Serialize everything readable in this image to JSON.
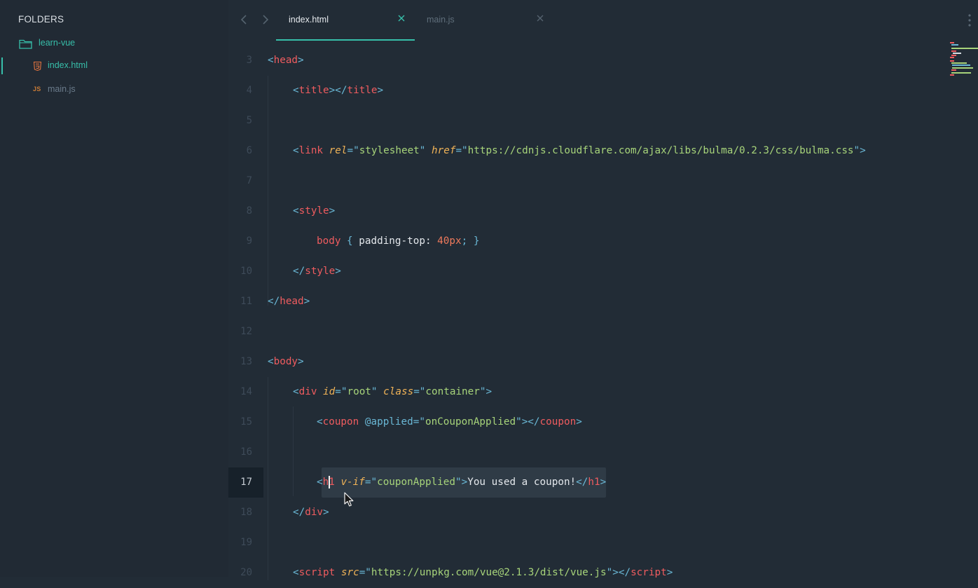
{
  "sidebar": {
    "header": "FOLDERS",
    "folder": {
      "name": "learn-vue",
      "icon": "folder-icon"
    },
    "files": [
      {
        "name": "index.html",
        "icon": "html5-icon",
        "active": true
      },
      {
        "name": "main.js",
        "icon": "js-icon",
        "icon_text": "JS",
        "active": false
      }
    ]
  },
  "tabs": [
    {
      "label": "index.html",
      "active": true
    },
    {
      "label": "main.js",
      "active": false
    }
  ],
  "editor": {
    "current_line": "17",
    "lines": [
      {
        "num": "3",
        "indent": 0,
        "tokens": [
          [
            "p",
            "<"
          ],
          [
            "t",
            "head"
          ],
          [
            "p",
            ">"
          ]
        ]
      },
      {
        "num": "4",
        "indent": 1,
        "tokens": [
          [
            "p",
            "<"
          ],
          [
            "t",
            "title"
          ],
          [
            "p",
            "></"
          ],
          [
            "t",
            "title"
          ],
          [
            "p",
            ">"
          ]
        ]
      },
      {
        "num": "5",
        "indent": 1,
        "tokens": []
      },
      {
        "num": "6",
        "indent": 1,
        "tokens": [
          [
            "p",
            "<"
          ],
          [
            "t",
            "link"
          ],
          [
            "w",
            " "
          ],
          [
            "a",
            "rel"
          ],
          [
            "p",
            "=\""
          ],
          [
            "s",
            "stylesheet"
          ],
          [
            "p",
            "\""
          ],
          [
            "w",
            " "
          ],
          [
            "a",
            "href"
          ],
          [
            "p",
            "=\""
          ],
          [
            "s",
            "https://cdnjs.cloudflare.com/ajax/libs/bulma/0.2.3/css/bulma.css"
          ],
          [
            "p",
            "\">"
          ]
        ]
      },
      {
        "num": "7",
        "indent": 1,
        "tokens": []
      },
      {
        "num": "8",
        "indent": 1,
        "tokens": [
          [
            "p",
            "<"
          ],
          [
            "t",
            "style"
          ],
          [
            "p",
            ">"
          ]
        ]
      },
      {
        "num": "9",
        "indent": 2,
        "tokens": [
          [
            "t",
            "body"
          ],
          [
            "w",
            " "
          ],
          [
            "p",
            "{"
          ],
          [
            "w",
            " padding-top: "
          ],
          [
            "n",
            "40px"
          ],
          [
            "p",
            ";"
          ],
          [
            "w",
            " "
          ],
          [
            "p",
            "}"
          ]
        ]
      },
      {
        "num": "10",
        "indent": 1,
        "tokens": [
          [
            "p",
            "</"
          ],
          [
            "t",
            "style"
          ],
          [
            "p",
            ">"
          ]
        ]
      },
      {
        "num": "11",
        "indent": 0,
        "tokens": [
          [
            "p",
            "</"
          ],
          [
            "t",
            "head"
          ],
          [
            "p",
            ">"
          ]
        ]
      },
      {
        "num": "12",
        "indent": 0,
        "tokens": []
      },
      {
        "num": "13",
        "indent": 0,
        "tokens": [
          [
            "p",
            "<"
          ],
          [
            "t",
            "body"
          ],
          [
            "p",
            ">"
          ]
        ]
      },
      {
        "num": "14",
        "indent": 1,
        "tokens": [
          [
            "p",
            "<"
          ],
          [
            "t",
            "div"
          ],
          [
            "w",
            " "
          ],
          [
            "a",
            "id"
          ],
          [
            "p",
            "=\""
          ],
          [
            "s",
            "root"
          ],
          [
            "p",
            "\""
          ],
          [
            "w",
            " "
          ],
          [
            "a",
            "class"
          ],
          [
            "p",
            "=\""
          ],
          [
            "s",
            "container"
          ],
          [
            "p",
            "\">"
          ]
        ]
      },
      {
        "num": "15",
        "indent": 2,
        "tokens": [
          [
            "p",
            "<"
          ],
          [
            "t",
            "coupon"
          ],
          [
            "w",
            " "
          ],
          [
            "p",
            "@applied"
          ],
          [
            "p",
            "=\""
          ],
          [
            "s",
            "onCouponApplied"
          ],
          [
            "p",
            "\"></"
          ],
          [
            "t",
            "coupon"
          ],
          [
            "p",
            ">"
          ]
        ]
      },
      {
        "num": "16",
        "indent": 2,
        "tokens": []
      },
      {
        "num": "17",
        "indent": 2,
        "tokens": [
          [
            "p",
            "<"
          ],
          [
            "t",
            "h1"
          ],
          [
            "w",
            " "
          ],
          [
            "a",
            "v-if"
          ],
          [
            "p",
            "=\""
          ],
          [
            "s",
            "couponApplied"
          ],
          [
            "p",
            "\">"
          ],
          [
            "w",
            "You used a coupon!"
          ],
          [
            "p",
            "</"
          ],
          [
            "t",
            "h1"
          ],
          [
            "p",
            ">"
          ]
        ]
      },
      {
        "num": "18",
        "indent": 1,
        "tokens": [
          [
            "p",
            "</"
          ],
          [
            "t",
            "div"
          ],
          [
            "p",
            ">"
          ]
        ]
      },
      {
        "num": "19",
        "indent": 1,
        "tokens": []
      },
      {
        "num": "20",
        "indent": 1,
        "tokens": [
          [
            "p",
            "<"
          ],
          [
            "t",
            "script"
          ],
          [
            "w",
            " "
          ],
          [
            "a",
            "src"
          ],
          [
            "p",
            "=\""
          ],
          [
            "s",
            "https://unpkg.com/vue@2.1.3/dist/vue.js"
          ],
          [
            "p",
            "\"></"
          ],
          [
            "t",
            "script"
          ],
          [
            "p",
            ">"
          ]
        ]
      }
    ]
  },
  "colors": {
    "accent": "#37bfaa",
    "background": "#222c36",
    "punctuation": "#6ab8d6",
    "tag": "#ef5c5f",
    "attribute": "#f0b357",
    "string": "#a7d47a",
    "number": "#ef7a5c"
  }
}
